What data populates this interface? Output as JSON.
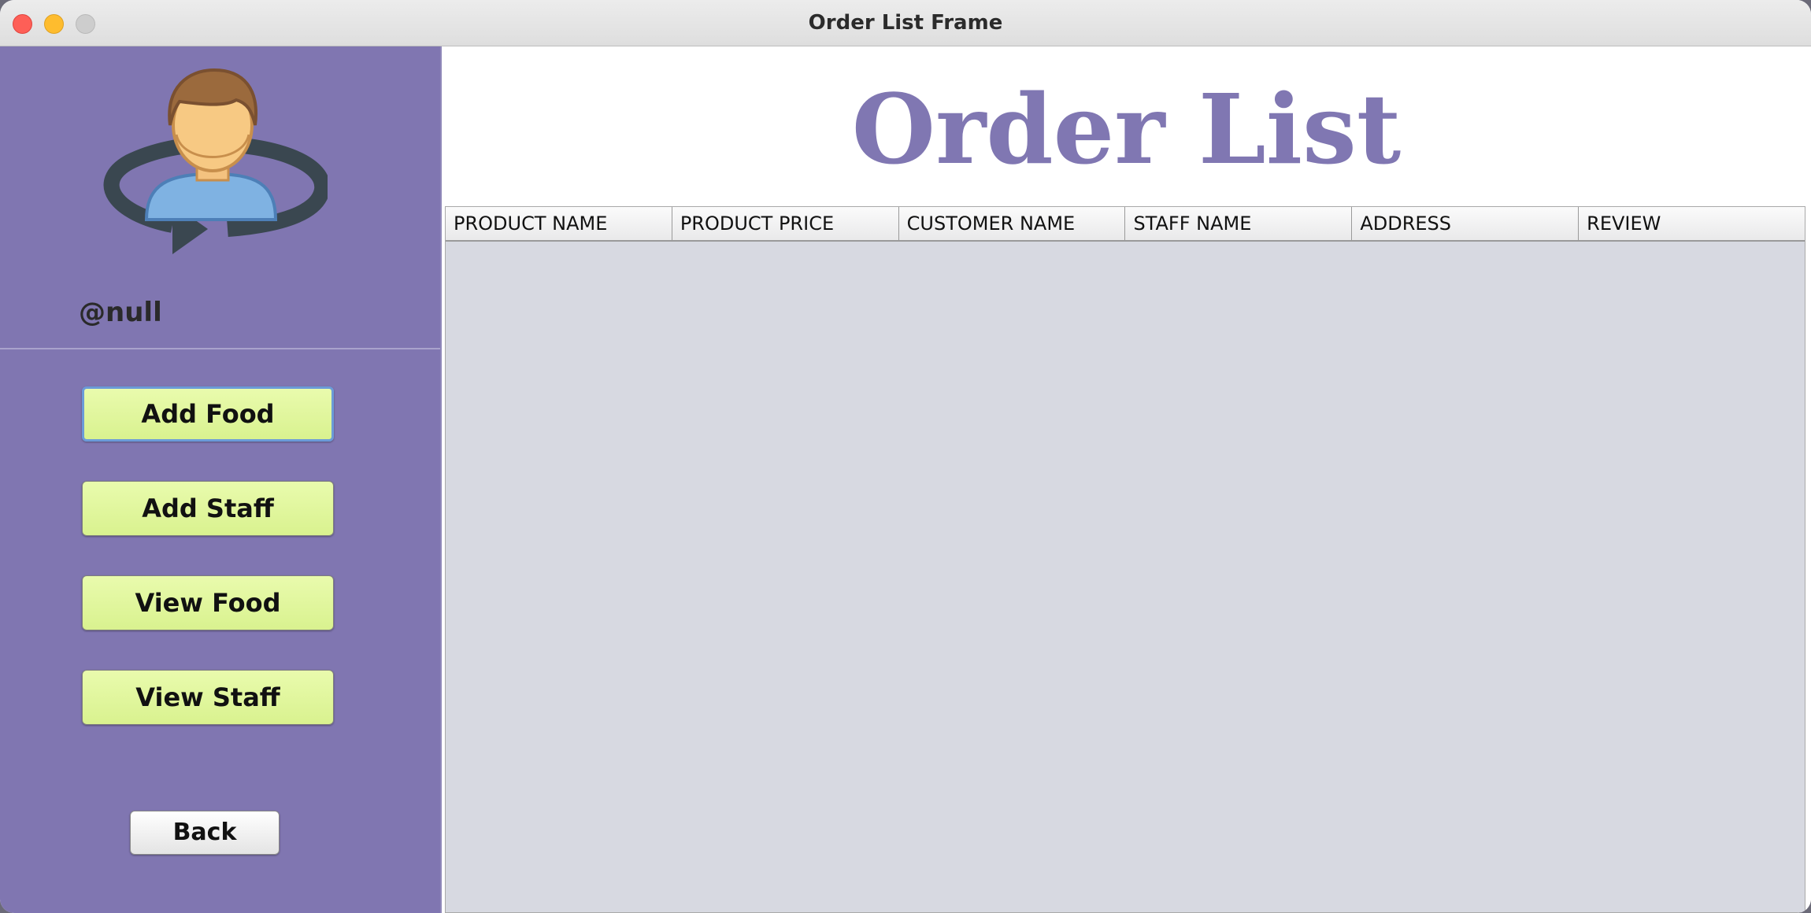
{
  "window": {
    "title": "Order List Frame"
  },
  "sidebar": {
    "username": "@null",
    "buttons": [
      "Add Food",
      "Add Staff",
      "View Food",
      "View Staff"
    ],
    "back_label": "Back"
  },
  "main": {
    "title": "Order List",
    "table": {
      "columns": [
        "PRODUCT NAME",
        "PRODUCT PRICE",
        "CUSTOMER NAME",
        "STAFF NAME",
        "ADDRESS",
        "REVIEW"
      ],
      "rows": []
    }
  },
  "colors": {
    "sidebar_bg": "#8076b1",
    "button_bg": "#dff59a",
    "title_color": "#8077b2",
    "table_bg": "#d7d9e1"
  },
  "icons": [
    "user-avatar-icon",
    "refresh-arrow-icon"
  ]
}
